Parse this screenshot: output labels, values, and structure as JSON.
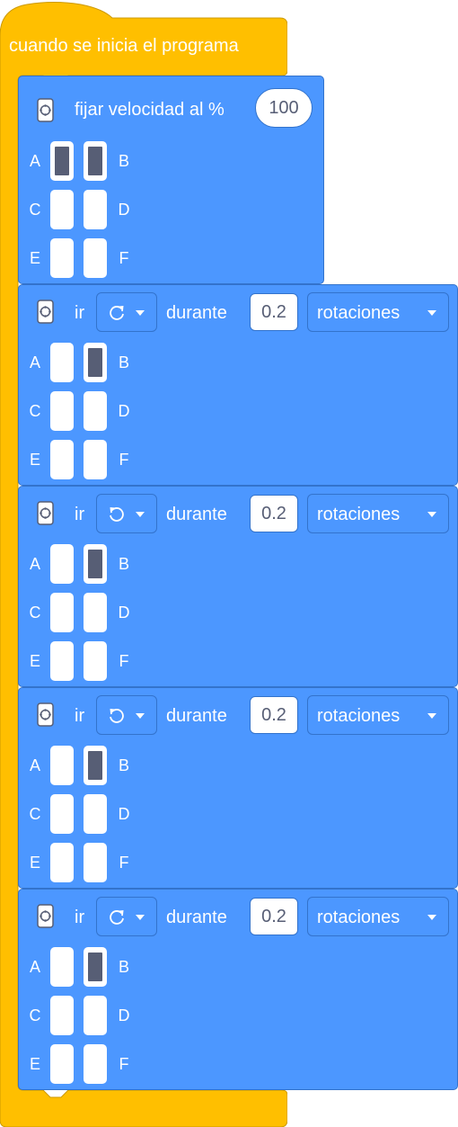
{
  "hat": {
    "label": "cuando se inicia el programa",
    "color": "#ffbf00"
  },
  "colors": {
    "block": "#4c97ff",
    "border": "#3373cc",
    "port_active": "#575e75"
  },
  "speed_block": {
    "label": "fijar velocidad al %",
    "value": "100",
    "ports": [
      {
        "left": "A",
        "right": "B",
        "left_on": true,
        "right_on": true
      },
      {
        "left": "C",
        "right": "D",
        "left_on": false,
        "right_on": false
      },
      {
        "left": "E",
        "right": "F",
        "left_on": false,
        "right_on": false
      }
    ]
  },
  "move_blocks": [
    {
      "verb": "ir",
      "direction_icon": "rotate-clockwise-icon",
      "during": "durante",
      "amount": "0.2",
      "unit": "rotaciones",
      "active_port": "B"
    },
    {
      "verb": "ir",
      "direction_icon": "rotate-counterclockwise-icon",
      "during": "durante",
      "amount": "0.2",
      "unit": "rotaciones",
      "active_port": "B"
    },
    {
      "verb": "ir",
      "direction_icon": "rotate-counterclockwise-icon",
      "during": "durante",
      "amount": "0.2",
      "unit": "rotaciones",
      "active_port": "B"
    },
    {
      "verb": "ir",
      "direction_icon": "rotate-clockwise-icon",
      "during": "durante",
      "amount": "0.2",
      "unit": "rotaciones",
      "active_port": "B"
    }
  ],
  "port_letters": [
    [
      "A",
      "B"
    ],
    [
      "C",
      "D"
    ],
    [
      "E",
      "F"
    ]
  ]
}
